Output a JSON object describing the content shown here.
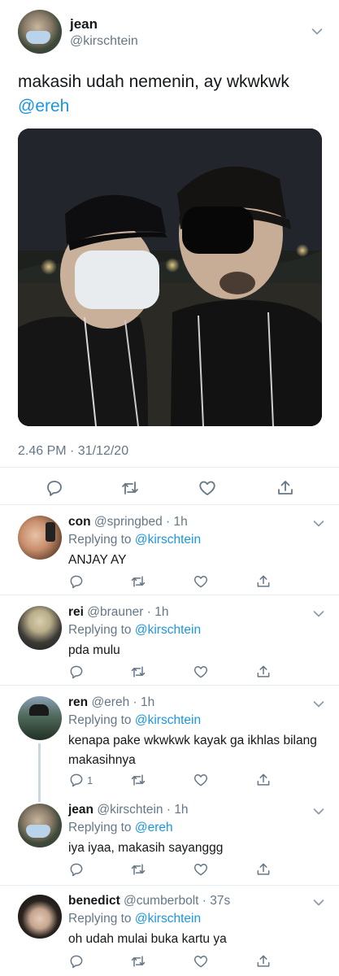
{
  "tweet": {
    "name": "jean",
    "handle": "@kirschtein",
    "text": "makasih udah nemenin, ay wkwkwk",
    "mention": "@ereh",
    "timestamp": "2.46 PM · 31/12/20"
  },
  "replies": [
    {
      "name": "con",
      "handle": "@springbed",
      "time": "1h",
      "replying_prefix": "Replying to",
      "replying_to": "@kirschtein",
      "text": "ANJAY AY",
      "reply_count": ""
    },
    {
      "name": "rei",
      "handle": "@brauner",
      "time": "1h",
      "replying_prefix": "Replying to",
      "replying_to": "@kirschtein",
      "text": "pda mulu",
      "reply_count": ""
    },
    {
      "name": "ren",
      "handle": "@ereh",
      "time": "1h",
      "replying_prefix": "Replying to",
      "replying_to": "@kirschtein",
      "text": "kenapa pake wkwkwk kayak ga ikhlas bilang makasihnya",
      "reply_count": "1"
    },
    {
      "name": "jean",
      "handle": "@kirschtein",
      "time": "1h",
      "replying_prefix": "Replying to",
      "replying_to": "@ereh",
      "text": "iya iyaa, makasih sayanggg",
      "reply_count": ""
    },
    {
      "name": "benedict",
      "handle": "@cumberbolt",
      "time": "37s",
      "replying_prefix": "Replying to",
      "replying_to": "@kirschtein",
      "text": "oh udah mulai buka kartu ya",
      "reply_count": ""
    }
  ],
  "colors": {
    "link": "#1b95e0",
    "secondary": "#657786",
    "divider": "#e6ecf0"
  },
  "icons": [
    "reply-icon",
    "retweet-icon",
    "like-icon",
    "share-icon",
    "chevron-down-icon"
  ]
}
